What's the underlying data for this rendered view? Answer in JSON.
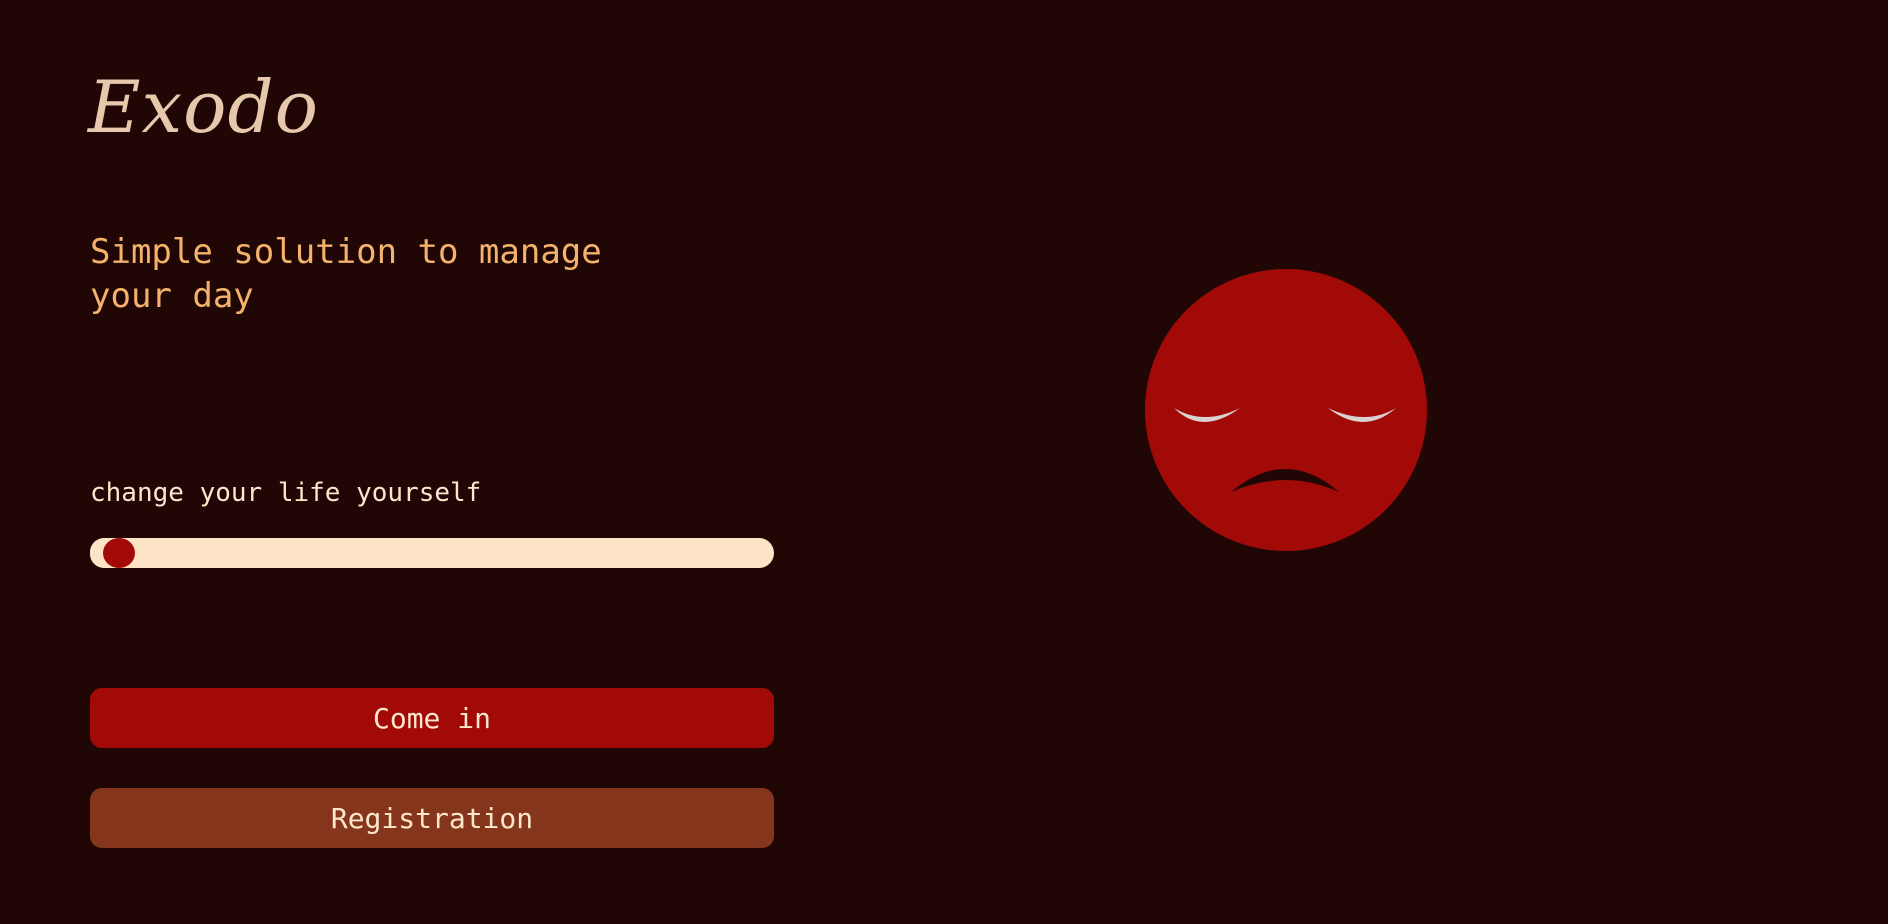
{
  "brand": {
    "logo": "Exodo"
  },
  "hero": {
    "tagline": "Simple solution to manage your day",
    "subtitle": "change your life yourself"
  },
  "mood_slider": {
    "value_percent": 2
  },
  "buttons": {
    "login_label": "Come in",
    "register_label": "Registration"
  },
  "mood_face": {
    "expression": "sad",
    "icon": "sad-face-icon"
  },
  "colors": {
    "background": "#200705",
    "accent_red": "#a20a08",
    "accent_brown": "#85351b",
    "cream": "#fde4c7",
    "orange_text": "#f4b26a",
    "logo": "#e6c9ad"
  }
}
